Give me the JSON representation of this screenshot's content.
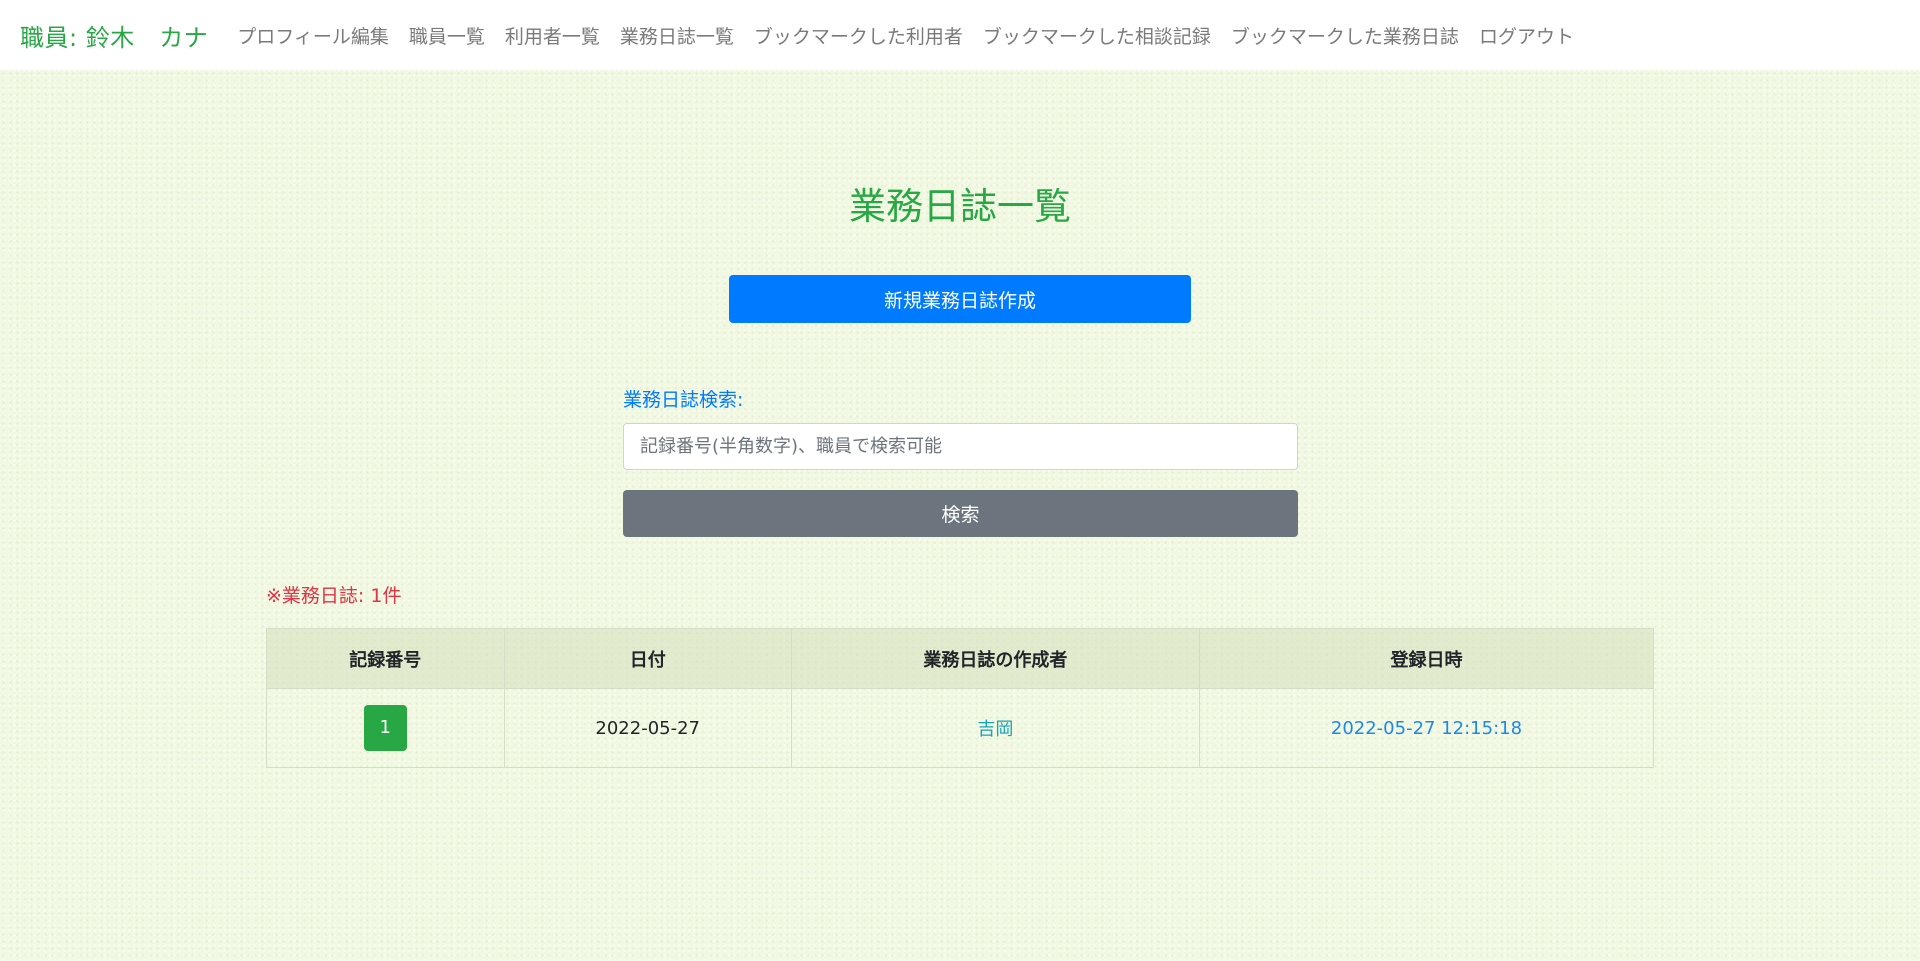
{
  "navbar": {
    "brand": "職員: 鈴木　カナ",
    "links": [
      "プロフィール編集",
      "職員一覧",
      "利用者一覧",
      "業務日誌一覧",
      "ブックマークした利用者",
      "ブックマークした相談記録",
      "ブックマークした業務日誌",
      "ログアウト"
    ]
  },
  "main": {
    "title": "業務日誌一覧",
    "new_button_label": "新規業務日誌作成",
    "search": {
      "label": "業務日誌検索:",
      "placeholder": "記録番号(半角数字)、職員で検索可能",
      "value": "",
      "button_label": "検索"
    },
    "count_note": "※業務日誌: 1件",
    "table": {
      "headers": [
        "記録番号",
        "日付",
        "業務日誌の作成者",
        "登録日時"
      ],
      "rows": [
        {
          "record_no": "1",
          "date": "2022-05-27",
          "author": "吉岡",
          "registered_at": "2022-05-27 12:15:18"
        }
      ]
    }
  },
  "colors": {
    "brand_green": "#28a745",
    "primary_blue": "#007bff",
    "secondary_gray": "#6c757d",
    "danger_red": "#dc3545",
    "background": "#f1f8e1"
  }
}
